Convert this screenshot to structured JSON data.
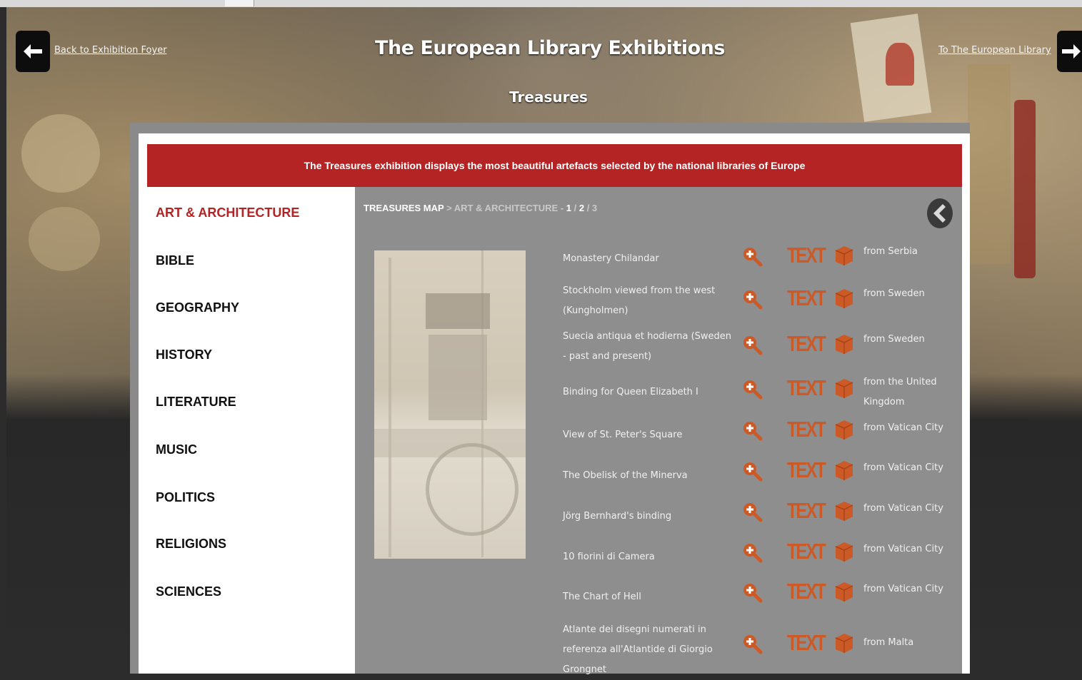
{
  "header": {
    "back_link": "Back to Exhibition Foyer",
    "title": "The European Library Exhibitions",
    "subtitle": "Treasures",
    "forward_link": "To The European Library"
  },
  "banner": "The Treasures exhibition displays the most beautiful artefacts selected by the national libraries of Europe",
  "sidebar": {
    "items": [
      {
        "label": "ART & ARCHITECTURE",
        "active": true
      },
      {
        "label": "BIBLE"
      },
      {
        "label": "GEOGRAPHY"
      },
      {
        "label": "HISTORY"
      },
      {
        "label": "LITERATURE"
      },
      {
        "label": "MUSIC"
      },
      {
        "label": "POLITICS"
      },
      {
        "label": "RELIGIONS"
      },
      {
        "label": "SCIENCES"
      }
    ]
  },
  "breadcrumb": {
    "root": "TREASURES MAP",
    "sep": " > ",
    "section": "ART & ARCHITECTURE",
    "dash": " - ",
    "page1": "1",
    "slash1": " / ",
    "page2": "2",
    "slash2": " / ",
    "page3": "3"
  },
  "items": [
    {
      "name": "Monastery Chilandar",
      "text_label": "TEXT",
      "from": "from Serbia"
    },
    {
      "name": "Stockholm viewed from the west (Kungholmen)",
      "text_label": "TEXT",
      "from": "from Sweden"
    },
    {
      "name": "Suecia antiqua et hodierna (Sweden - past and present)",
      "text_label": "TEXT",
      "from": "from Sweden"
    },
    {
      "name": "Binding for Queen Elizabeth I",
      "text_label": "TEXT",
      "from": "from the United Kingdom"
    },
    {
      "name": "View of St. Peter's Square",
      "text_label": "TEXT",
      "from": "from Vatican City"
    },
    {
      "name": "The Obelisk of the Minerva",
      "text_label": "TEXT",
      "from": "from Vatican City"
    },
    {
      "name": "Jörg Bernhard's binding",
      "text_label": "TEXT",
      "from": "from Vatican City"
    },
    {
      "name": "10 fiorini di Camera",
      "text_label": "TEXT",
      "from": "from Vatican City"
    },
    {
      "name": "The Chart of Hell",
      "text_label": "TEXT",
      "from": "from Vatican City"
    },
    {
      "name": "Atlante dei disegni numerati in referenza all'Atlantide di Giorgio Grongnet",
      "text_label": "TEXT",
      "from": "from Malta"
    }
  ],
  "colors": {
    "accent": "#b52424",
    "icon": "#cc5a27",
    "content_bg": "#8e8e8e"
  },
  "icons": {
    "back": "arrow-left-icon",
    "forward": "arrow-right-icon",
    "zoom": "magnifier-plus-icon",
    "box": "cube-icon",
    "previous": "chevron-left-circle-icon"
  }
}
